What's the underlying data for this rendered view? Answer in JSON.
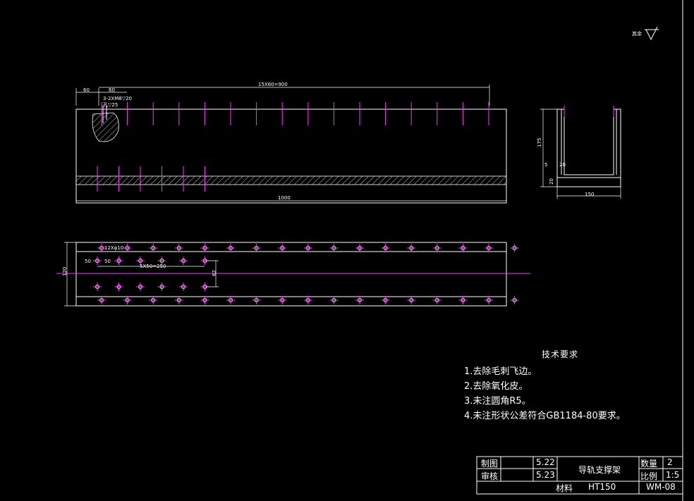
{
  "roughness": {
    "label": "其余"
  },
  "front_view": {
    "top_dimension": "15X60=900",
    "left_offset": "60",
    "first_pitch": "60",
    "hole_callout": "3-2XM8▽20",
    "hole_callout2": "孔▽25",
    "overall_length": "1000",
    "hole_count": 16,
    "lower_hole_count": 6
  },
  "side_view": {
    "height": "175",
    "base": "20",
    "wall": "20",
    "step": "5",
    "width": "150"
  },
  "plan_view": {
    "hole_callout": "12Xφ10",
    "group_dim": "5X50=250",
    "left_gap": "50",
    "left_gap2": "50",
    "spacing_v": "62",
    "width": "120",
    "edge_hole_count": 17,
    "inner_hole_count": 6
  },
  "notes": {
    "title": "技术要求",
    "items": [
      "1.去除毛刺飞边。",
      "2.去除氧化皮。",
      "3.未注圆角R5。",
      "4.未注形状公差符合GB1184-80要求。"
    ]
  },
  "title_block": {
    "drawn_label": "制图",
    "drawn_date": "5.22",
    "checked_label": "审核",
    "checked_date": "5.23",
    "part_name": "导轨支撑架",
    "qty_label": "数量",
    "qty_value": "2",
    "scale_label": "比例",
    "scale_value": "1:5",
    "material_label": "材料",
    "material_value": "HT150",
    "drawing_no": "WM-08"
  },
  "colors": {
    "background": "#000000",
    "line": "#ffffff",
    "center": "#ff33ff"
  }
}
